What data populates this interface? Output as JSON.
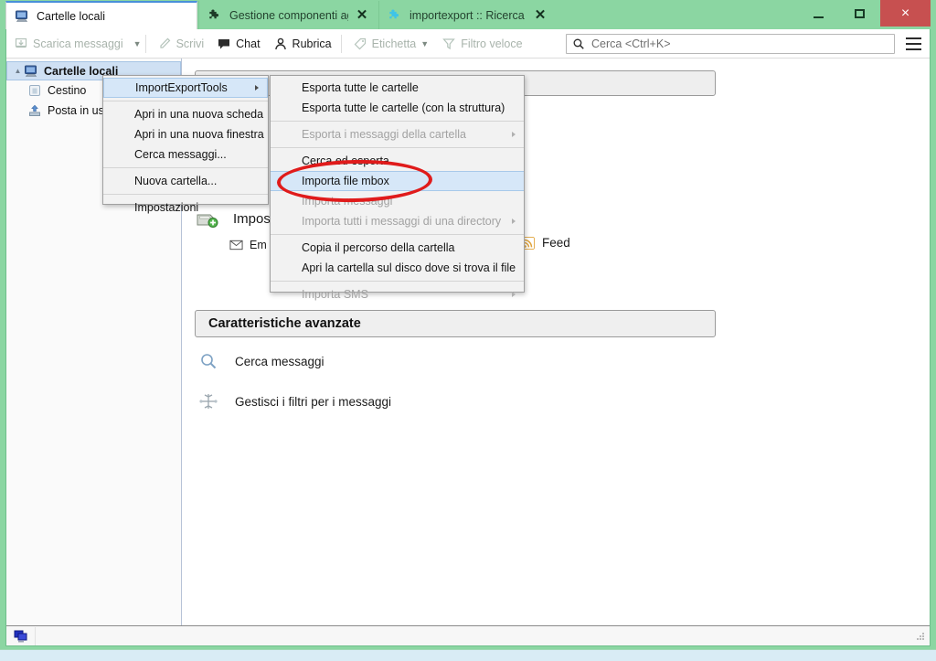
{
  "window": {
    "minimize_label": "Riduci a icona",
    "maximize_label": "Ingrandisci",
    "close_label": "×"
  },
  "tabs": [
    {
      "label": "Cartelle locali",
      "icon": "local-folders-icon",
      "active": true,
      "closable": false
    },
    {
      "label": "Gestione componenti aggiu",
      "icon": "addons-puzzle-icon",
      "active": false,
      "closable": true,
      "close_label": "✕"
    },
    {
      "label": "importexport :: Ricerca :: Co",
      "icon": "addons-puzzle-blue-icon",
      "active": false,
      "closable": true,
      "close_label": "✕"
    }
  ],
  "toolbar": {
    "get_messages": "Scarica messaggi",
    "get_messages_caret": "▼",
    "write": "Scrivi",
    "chat": "Chat",
    "address_book": "Rubrica",
    "tag": "Etichetta",
    "tag_caret": "▼",
    "quick_filter": "Filtro veloce",
    "search_placeholder": "Cerca <Ctrl+K>",
    "menu_button": "app-menu"
  },
  "sidebar": {
    "items": [
      {
        "label": "Cartelle locali",
        "icon": "local-folders-icon",
        "selected": true,
        "twisty": "▲"
      },
      {
        "label": "Cestino",
        "icon": "trash-icon",
        "selected": false,
        "twisty": ""
      },
      {
        "label": "Posta in uscit",
        "icon": "outbox-icon",
        "selected": false,
        "twisty": ""
      }
    ]
  },
  "content": {
    "setup_account_label": "Impos",
    "email_label": "Em",
    "feed_label": "Feed",
    "advanced_title": "Caratteristiche avanzate",
    "advanced_items": [
      {
        "label": "Cerca messaggi",
        "icon": "magnifier-icon"
      },
      {
        "label": "Gestisci i filtri per i messaggi",
        "icon": "filters-icon"
      }
    ]
  },
  "context_menu": {
    "items": [
      {
        "label": "ImportExportTools",
        "highlighted": true,
        "submenu": true,
        "disabled": false,
        "accel": ""
      },
      {
        "separator": true
      },
      {
        "label": "Apri in una nuova scheda",
        "accel": "A",
        "disabled": false,
        "submenu": false
      },
      {
        "label": "Apri in una nuova finestra",
        "accel": "A",
        "disabled": false,
        "submenu": false
      },
      {
        "label": "Cerca messaggi...",
        "accel": "C",
        "disabled": false,
        "submenu": false
      },
      {
        "separator": true
      },
      {
        "label": "Nuova cartella...",
        "accel": "N",
        "disabled": false,
        "submenu": false
      },
      {
        "separator": true
      },
      {
        "label": "Impostazioni",
        "accel": "I",
        "disabled": false,
        "submenu": false
      }
    ]
  },
  "submenu": {
    "items": [
      {
        "label": "Esporta tutte le cartelle",
        "disabled": false,
        "submenu": false,
        "highlighted": false
      },
      {
        "label": "Esporta tutte le cartelle (con la struttura)",
        "disabled": false,
        "submenu": false,
        "highlighted": false
      },
      {
        "separator": true
      },
      {
        "label": "Esporta i messaggi della cartella",
        "disabled": true,
        "submenu": true,
        "highlighted": false
      },
      {
        "separator": true
      },
      {
        "label": "Cerca ed esporta",
        "disabled": false,
        "submenu": false,
        "highlighted": false
      },
      {
        "label": "Importa file mbox",
        "disabled": false,
        "submenu": false,
        "highlighted": true
      },
      {
        "label": "Importa messaggi",
        "disabled": true,
        "submenu": false,
        "highlighted": false
      },
      {
        "label": "Importa tutti i messaggi di una directory",
        "disabled": true,
        "submenu": true,
        "highlighted": false
      },
      {
        "separator": true
      },
      {
        "label": "Copia il percorso della cartella",
        "disabled": false,
        "submenu": false,
        "highlighted": false
      },
      {
        "label": "Apri la cartella sul disco dove si trova il file",
        "disabled": false,
        "submenu": false,
        "highlighted": false
      },
      {
        "separator": true
      },
      {
        "label": "Importa SMS",
        "disabled": true,
        "submenu": true,
        "highlighted": false
      }
    ]
  },
  "annotation": {
    "shape": "ellipse",
    "color": "#e01b1b",
    "targets_item": "Importa file mbox"
  },
  "colors": {
    "frame": "#8bd6a2",
    "active_tab": "#ffffff",
    "active_tab_border": "#4a90d9",
    "close_button": "#c75050",
    "menu_bg": "#f2f2f2",
    "menu_highlight": "#d6e7f8",
    "selection": "#cfe0f3",
    "annotation_red": "#e01b1b"
  }
}
